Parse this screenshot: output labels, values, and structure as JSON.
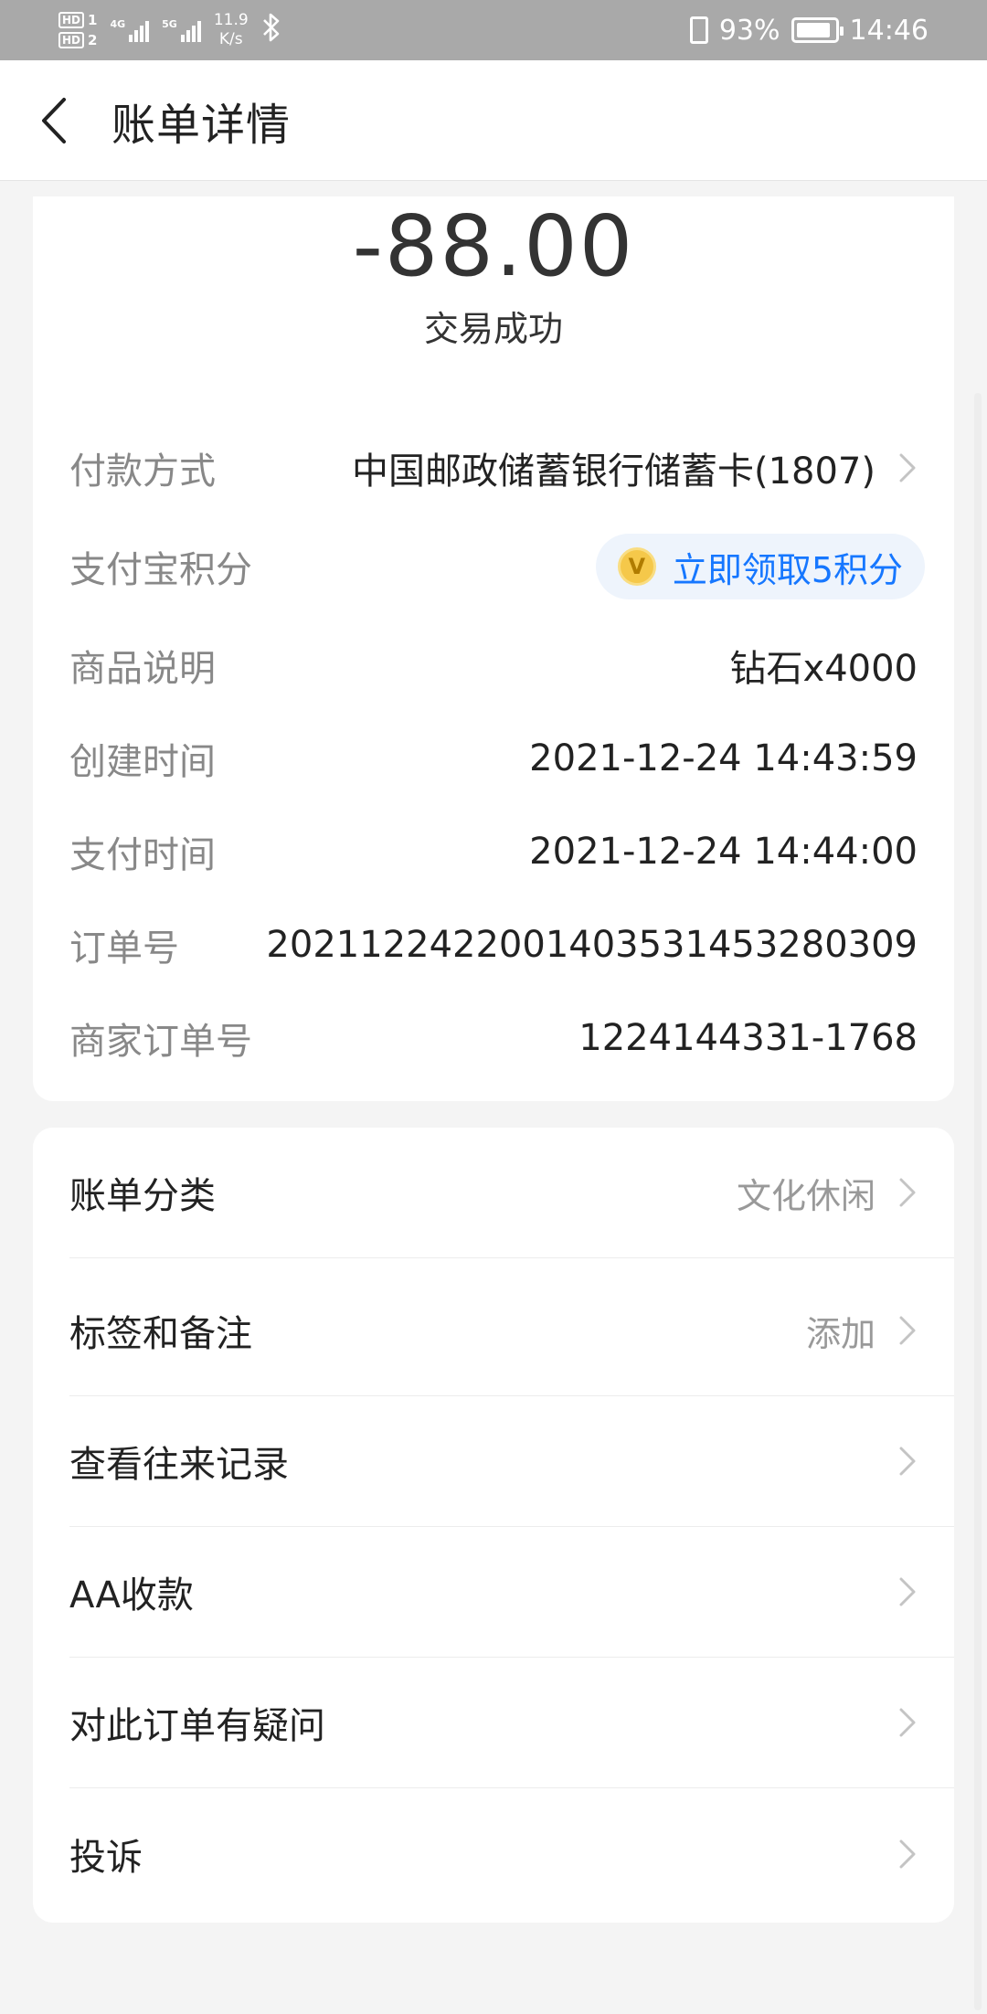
{
  "status_bar": {
    "hd1": "HD",
    "hd1_num": "1",
    "hd2": "HD",
    "hd2_num": "2",
    "sig1_label": "4G",
    "sig2_label": "5G",
    "speed_value": "11.9",
    "speed_unit": "K/s",
    "battery": "93%",
    "time": "14:46",
    "bluetooth_icon": "bluetooth-icon",
    "vibrate_icon": "vibrate-icon"
  },
  "nav": {
    "title": "账单详情",
    "back_icon": "chevron-left-icon"
  },
  "summary": {
    "amount": "-88.00",
    "status": "交易成功"
  },
  "details": {
    "payment_method_label": "付款方式",
    "payment_method_value": "中国邮政储蓄银行储蓄卡(1807)",
    "points_label": "支付宝积分",
    "points_button": "立即领取5积分",
    "points_coin_glyph": "V",
    "product_label": "商品说明",
    "product_value": "钻石x4000",
    "created_label": "创建时间",
    "created_value": "2021-12-24 14:43:59",
    "paid_label": "支付时间",
    "paid_value": "2021-12-24 14:44:00",
    "order_label": "订单号",
    "order_value": "2021122422001403531453280309",
    "merchant_order_label": "商家订单号",
    "merchant_order_value": "1224144331-1768"
  },
  "menu": {
    "category_label": "账单分类",
    "category_value": "文化休闲",
    "tags_label": "标签和备注",
    "tags_value": "添加",
    "history_label": "查看往来记录",
    "aa_label": "AA收款",
    "question_label": "对此订单有疑问",
    "complaint_label": "投诉"
  },
  "colors": {
    "accent": "#1677ff",
    "status_bar_bg": "#a9a9a9",
    "page_bg": "#f4f4f4"
  }
}
